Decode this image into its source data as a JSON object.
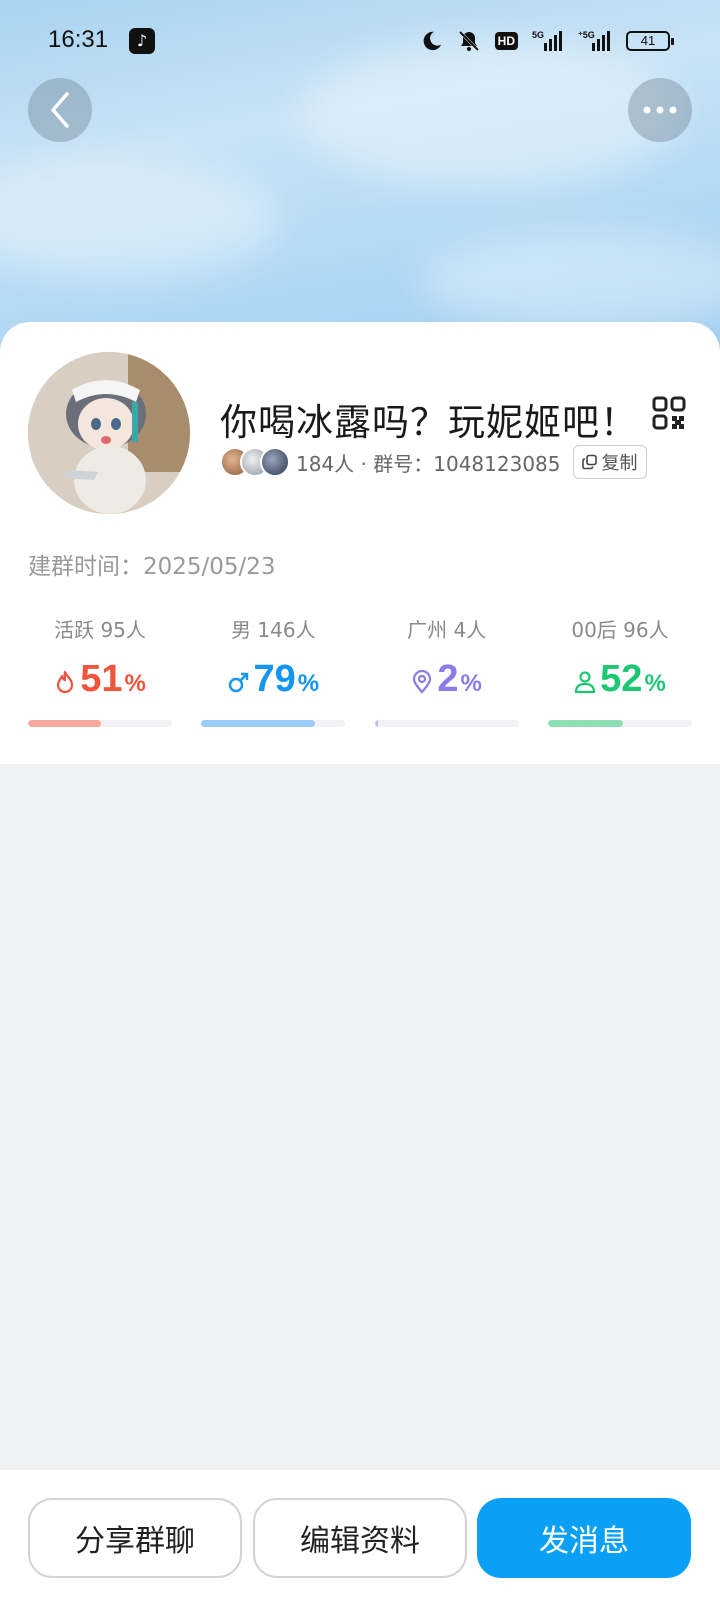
{
  "status_bar": {
    "time": "16:31",
    "hd_label": "HD",
    "battery": "41"
  },
  "header": {
    "back_icon": "chevron-left-icon",
    "more_icon": "ellipsis-icon"
  },
  "group": {
    "name": "你喝冰露吗？玩妮姬吧！",
    "meta": "184人 · 群号：1048123085",
    "copy_label": "复制",
    "created": "建群时间：2025/05/23"
  },
  "stats": [
    {
      "label": "活跃 95人",
      "value": "51",
      "percent_sign": "%",
      "fraction": 0.51,
      "color": "#f0543c",
      "bar_color": "#f8a89a",
      "icon": "flame-icon"
    },
    {
      "label": "男 146人",
      "value": "79",
      "percent_sign": "%",
      "fraction": 0.79,
      "color": "#1296f0",
      "bar_color": "#9ccbf7",
      "icon": "male-icon"
    },
    {
      "label": "广州 4人",
      "value": "2",
      "percent_sign": "%",
      "fraction": 0.02,
      "color": "#8a7ce8",
      "bar_color": "#c2b9f4",
      "icon": "location-pin-icon"
    },
    {
      "label": "00后 96人",
      "value": "52",
      "percent_sign": "%",
      "fraction": 0.52,
      "color": "#1ec774",
      "bar_color": "#8ee0b4",
      "icon": "person-icon"
    }
  ],
  "actions": {
    "share": "分享群聊",
    "edit": "编辑资料",
    "send": "发消息"
  },
  "colors": {
    "accent": "#0aa0f5",
    "page_bg": "#eff0f2"
  }
}
